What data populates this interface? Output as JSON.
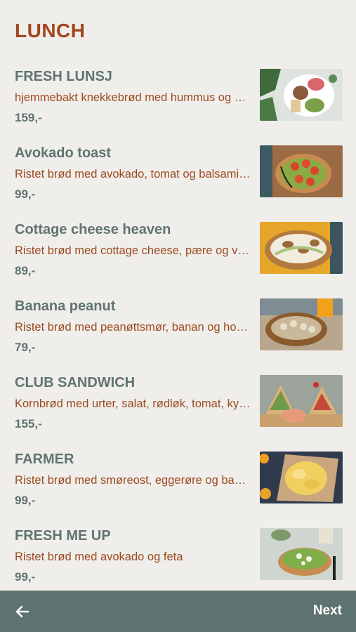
{
  "page": {
    "title": "LUNCH"
  },
  "menu": {
    "items": [
      {
        "name": "FRESH LUNSJ",
        "description": "hjemmebakt knekkebrød med hummus og grønnsaker",
        "price": "159,-",
        "image": "fresh-lunsj-image"
      },
      {
        "name": "Avokado toast",
        "description": "Ristet brød med avokado, tomat og balsamico",
        "price": "99,-",
        "image": "avokado-toast-image"
      },
      {
        "name": "Cottage cheese heaven",
        "description": "Ristet brød med cottage cheese, pære og valnøtter",
        "price": "89,-",
        "image": "cottage-cheese-image"
      },
      {
        "name": "Banana peanut",
        "description": "Ristet brød med peanøttsmør, banan og honning",
        "price": "79,-",
        "image": "banana-peanut-image"
      },
      {
        "name": "CLUB SANDWICH",
        "description": "Kornbrød med urter, salat, rødløk, tomat, kylling",
        "price": "155,-",
        "image": "club-sandwich-image"
      },
      {
        "name": "FARMER",
        "description": "Ristet brød med smøreost, eggerøre og bacon",
        "price": "99,-",
        "image": "farmer-image"
      },
      {
        "name": "FRESH ME UP",
        "description": "Ristet brød med avokado og feta",
        "price": "99,-",
        "image": "fresh-me-up-image"
      }
    ]
  },
  "nav": {
    "back_icon": "arrow-left-icon",
    "next_label": "Next"
  },
  "colors": {
    "accent": "#a0461f",
    "heading": "#5f7470",
    "bar": "#5e7370",
    "background": "#f0eeea"
  }
}
